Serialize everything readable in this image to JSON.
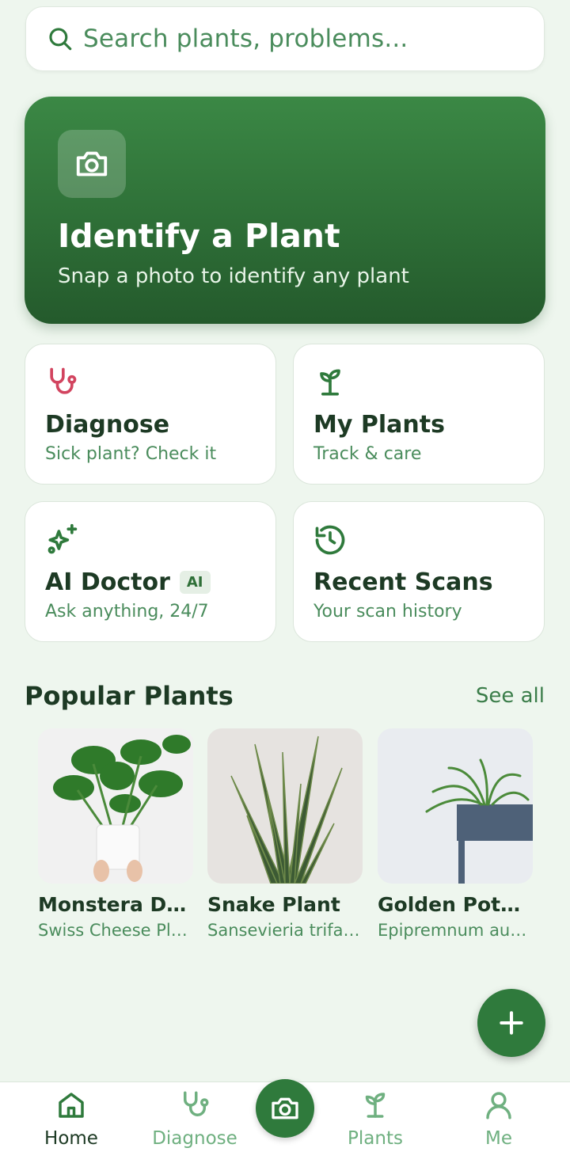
{
  "search": {
    "placeholder": "Search plants, problems..."
  },
  "hero": {
    "title": "Identify a Plant",
    "subtitle": "Snap a photo to identify any plant",
    "icon": "camera-icon"
  },
  "cards": [
    {
      "title": "Diagnose",
      "subtitle": "Sick plant? Check it",
      "icon": "stethoscope-icon",
      "icon_color": "#d2445f"
    },
    {
      "title": "My Plants",
      "subtitle": "Track & care",
      "icon": "sprout-icon",
      "icon_color": "#2f7a3c"
    },
    {
      "title": "AI Doctor",
      "badge": "AI",
      "subtitle": "Ask anything, 24/7",
      "icon": "sparkles-icon",
      "icon_color": "#2f7a3c"
    },
    {
      "title": "Recent Scans",
      "subtitle": "Your scan history",
      "icon": "history-icon",
      "icon_color": "#2f7a3c"
    }
  ],
  "popular": {
    "title": "Popular Plants",
    "see_all": "See all",
    "plants": [
      {
        "name": "Monstera Deliciosa",
        "scientific": "Swiss Cheese Plant"
      },
      {
        "name": "Snake Plant",
        "scientific": "Sansevieria trifasciata"
      },
      {
        "name": "Golden Pothos",
        "scientific": "Epipremnum aureum"
      }
    ]
  },
  "nav": {
    "items": [
      {
        "label": "Home",
        "icon": "home-icon",
        "active": true
      },
      {
        "label": "Diagnose",
        "icon": "stethoscope-icon",
        "active": false
      },
      {
        "label": "",
        "icon": "camera-icon",
        "active": false
      },
      {
        "label": "Plants",
        "icon": "sprout-icon",
        "active": false
      },
      {
        "label": "Me",
        "icon": "user-icon",
        "active": false
      }
    ]
  },
  "colors": {
    "accent": "#2f7a3c",
    "background": "#eef6ee",
    "diagnose": "#d2445f"
  }
}
